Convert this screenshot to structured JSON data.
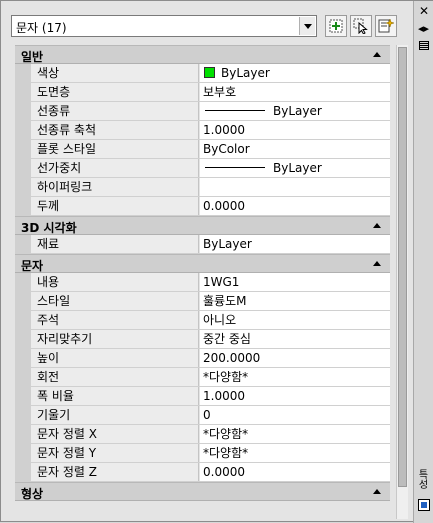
{
  "toolbar": {
    "selection_value": "문자 (17)",
    "buttons": [
      {
        "name": "toggle-pickadd-button",
        "icon": "plus-select-icon"
      },
      {
        "name": "select-objects-button",
        "icon": "cursor-select-icon"
      },
      {
        "name": "quick-select-button",
        "icon": "quick-select-icon"
      }
    ]
  },
  "categories": [
    {
      "title": "일반",
      "rows": [
        {
          "name": "색상",
          "value": "ByLayer",
          "kind": "color",
          "swatch": "#00e000"
        },
        {
          "name": "도면층",
          "value": "보부호"
        },
        {
          "name": "선종류",
          "value": "ByLayer",
          "kind": "linetype"
        },
        {
          "name": "선종류 축척",
          "value": "1.0000"
        },
        {
          "name": "플롯 스타일",
          "value": "ByColor"
        },
        {
          "name": "선가중치",
          "value": "ByLayer",
          "kind": "linetype"
        },
        {
          "name": "하이퍼링크",
          "value": ""
        },
        {
          "name": "두께",
          "value": "0.0000"
        }
      ]
    },
    {
      "title": "3D 시각화",
      "rows": [
        {
          "name": "재료",
          "value": "ByLayer"
        }
      ]
    },
    {
      "title": "문자",
      "rows": [
        {
          "name": "내용",
          "value": "1WG1"
        },
        {
          "name": "스타일",
          "value": "훌륭도M"
        },
        {
          "name": "주석",
          "value": "아니오"
        },
        {
          "name": "자리맞추기",
          "value": "중간 중심"
        },
        {
          "name": "높이",
          "value": "200.0000"
        },
        {
          "name": "회전",
          "value": "*다양함*"
        },
        {
          "name": "폭 비율",
          "value": "1.0000"
        },
        {
          "name": "기울기",
          "value": "0"
        },
        {
          "name": "문자 정렬 X",
          "value": "*다양함*"
        },
        {
          "name": "문자 정렬 Y",
          "value": "*다양함*"
        },
        {
          "name": "문자 정렬 Z",
          "value": "0.0000"
        }
      ]
    },
    {
      "title": "형상",
      "rows": []
    }
  ],
  "rail": {
    "close_icon": "close-icon",
    "pin_icon": "autohide-icon",
    "menu_icon": "properties-menu-icon",
    "title": "특성"
  }
}
